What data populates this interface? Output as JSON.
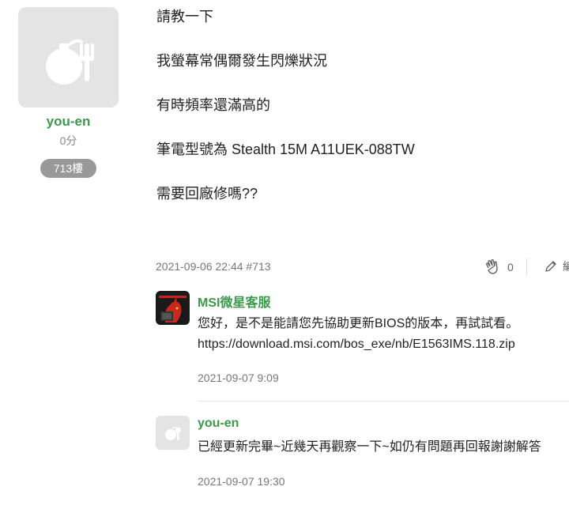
{
  "author": {
    "name": "you-en",
    "score": "0分",
    "floor": "713樓"
  },
  "post": {
    "lines": [
      "請教一下",
      "我螢幕常偶爾發生閃爍狀況",
      "有時頻率還滿高的",
      "筆電型號為 Stealth 15M A11UEK-088TW",
      "需要回廠修嗎??"
    ],
    "meta": "2021-09-06 22:44 #713",
    "like_count": "0",
    "edit_label": "編"
  },
  "replies": [
    {
      "name": "MSI微星客服",
      "lines": [
        "您好，是不是能請您先協助更新BIOS的版本，再試試看。",
        "https://download.msi.com/bos_exe/nb/E1563IMS.118.zip"
      ],
      "time": "2021-09-07 9:09"
    },
    {
      "name": "you-en",
      "lines": [
        "已經更新完畢~近幾天再觀察一下~如仍有問題再回報謝謝解答"
      ],
      "time": "2021-09-07 19:30"
    }
  ],
  "colors": {
    "accent_green": "#3a9a4a",
    "badge_gray": "#999999",
    "avatar_bg": "#e4e4e4"
  }
}
